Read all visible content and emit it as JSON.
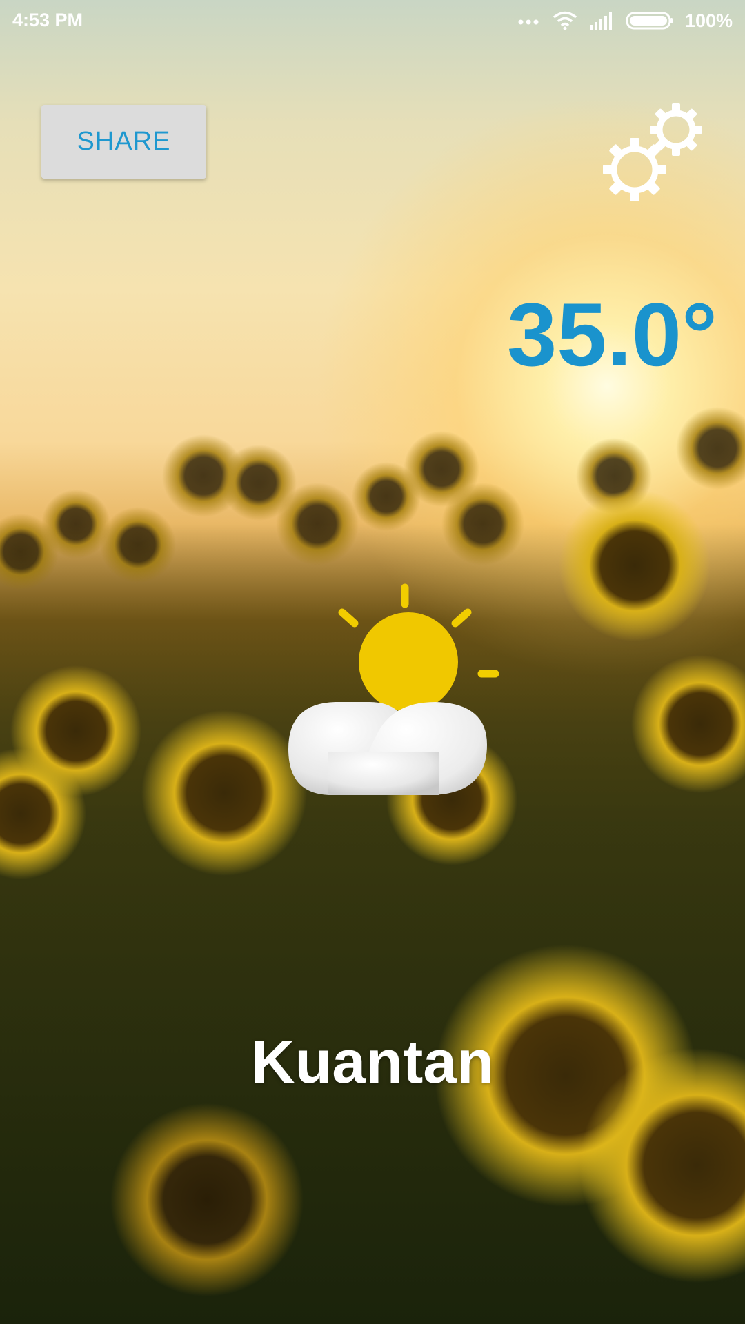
{
  "status_bar": {
    "time": "4:53 PM",
    "battery_text": "100%",
    "icons": [
      "more-dots-icon",
      "wifi-icon",
      "signal-icon",
      "battery-icon"
    ]
  },
  "share_button": {
    "label": "SHARE",
    "color": "#1f98cf"
  },
  "settings": {
    "icon": "gear-icon"
  },
  "weather": {
    "temperature": "35.0°",
    "condition_icon": "partly-cloudy-icon",
    "city": "Kuantan",
    "temperature_color": "#1a93cd"
  },
  "background": {
    "scene": "sunflower-field-sunset"
  }
}
